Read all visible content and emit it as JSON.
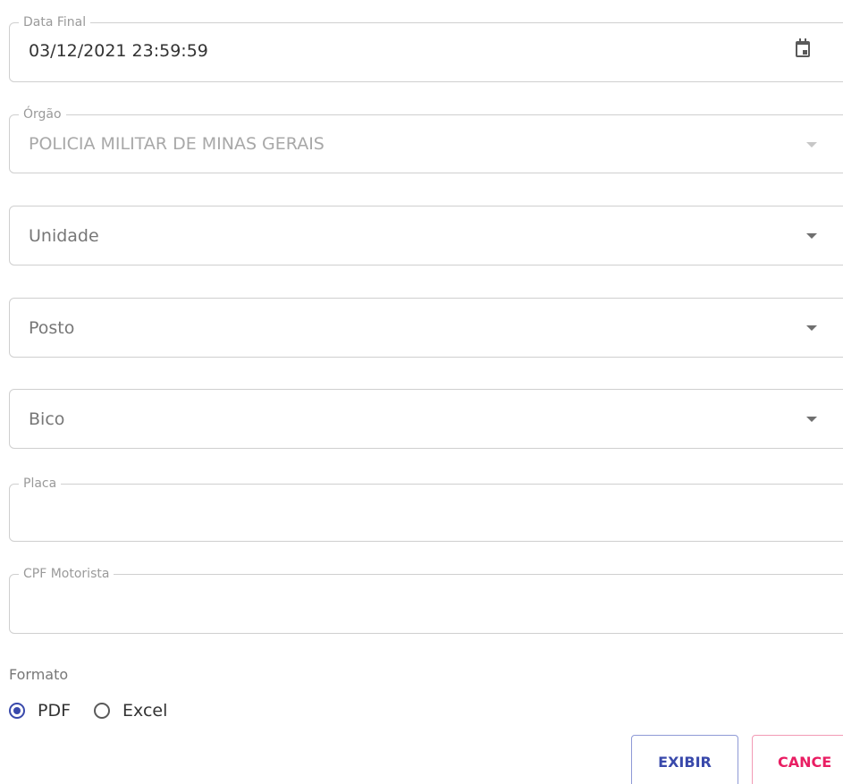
{
  "fields": {
    "data_final": {
      "label": "Data Final",
      "value": "03/12/2021 23:59:59",
      "icon": "calendar-icon"
    },
    "orgao": {
      "label": "Órgão",
      "value": "POLICIA MILITAR DE MINAS GERAIS",
      "disabled": true
    },
    "unidade": {
      "placeholder": "Unidade"
    },
    "posto": {
      "placeholder": "Posto"
    },
    "bico": {
      "placeholder": "Bico"
    },
    "placa": {
      "label": "Placa",
      "value": ""
    },
    "cpf_motorista": {
      "label": "CPF Motorista",
      "value": ""
    }
  },
  "formato": {
    "label": "Formato",
    "options": [
      {
        "label": "PDF",
        "selected": true
      },
      {
        "label": "Excel",
        "selected": false
      }
    ]
  },
  "buttons": {
    "exibir": "EXIBIR",
    "cancel": "CANCE"
  },
  "colors": {
    "primary": "#3949ab",
    "danger": "#e91e63",
    "border": "#cfcfcf"
  }
}
